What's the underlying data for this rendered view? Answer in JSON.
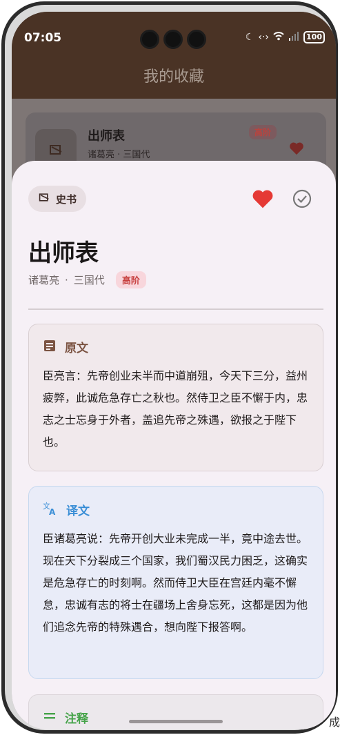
{
  "status": {
    "time": "07:05",
    "battery": "100"
  },
  "app": {
    "title": "我的收藏"
  },
  "background_card": {
    "title": "出师表",
    "author": "诸葛亮",
    "dynasty": "三国代",
    "level": "高阶"
  },
  "sheet": {
    "category": "史书",
    "title": "出师表",
    "author": "诸葛亮",
    "separator": "·",
    "dynasty": "三国代",
    "level": "高阶"
  },
  "original": {
    "heading": "原文",
    "text": "臣亮言：先帝创业未半而中道崩殂，今天下三分，益州疲弊，此诚危急存亡之秋也。然侍卫之臣不懈于内，忠志之士忘身于外者，盖追先帝之殊遇，欲报之于陛下也。"
  },
  "translation": {
    "heading": "译文",
    "text": "臣诸葛亮说：先帝开创大业未完成一半，竟中途去世。现在天下分裂成三个国家，我们蜀汉民力困乏，这确实是危急存亡的时刻啊。然而侍卫大臣在宫廷内毫不懈怠，忠诚有志的将士在疆场上舍身忘死，这都是因为他们追念先帝的特殊遇合，想向陛下报答啊。"
  },
  "notes": {
    "heading": "注释"
  },
  "corner": {
    "text": "成"
  },
  "colors": {
    "accent_brown": "#7b5342",
    "accent_blue": "#3a8ed6",
    "accent_green": "#46a34a",
    "heart": "#e53935",
    "badge_red": "#c7403f"
  },
  "icons": [
    "book-icon",
    "heart-icon",
    "check-circle-icon",
    "document-icon",
    "translate-icon",
    "list-icon"
  ]
}
